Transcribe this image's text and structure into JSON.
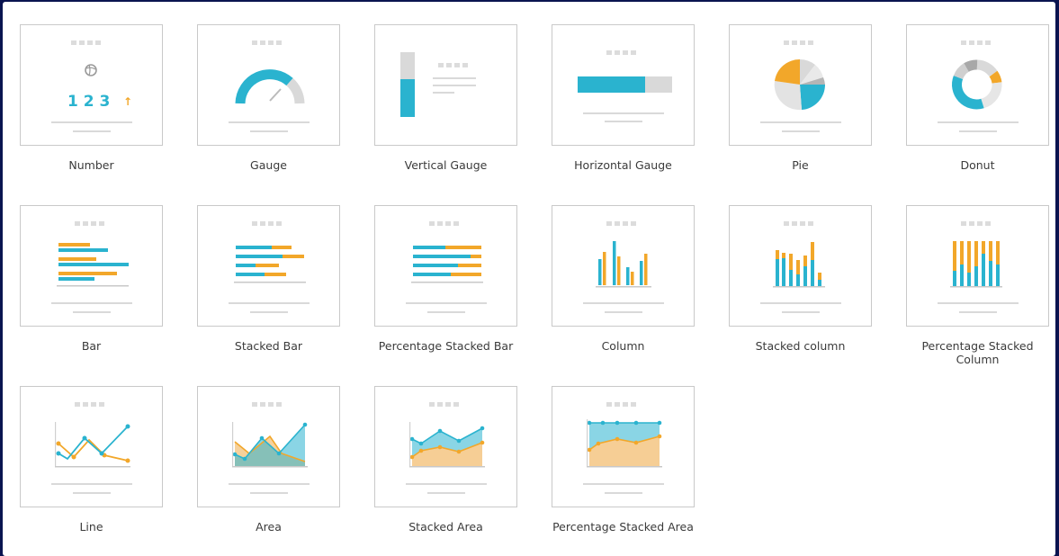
{
  "chart_types": [
    {
      "label": "Number",
      "icon": "number-icon"
    },
    {
      "label": "Gauge",
      "icon": "gauge-icon"
    },
    {
      "label": "Vertical Gauge",
      "icon": "vertical-gauge-icon"
    },
    {
      "label": "Horizontal Gauge",
      "icon": "horizontal-gauge-icon"
    },
    {
      "label": "Pie",
      "icon": "pie-chart-icon"
    },
    {
      "label": "Donut",
      "icon": "donut-chart-icon"
    },
    {
      "label": "Bar",
      "icon": "bar-chart-icon"
    },
    {
      "label": "Stacked Bar",
      "icon": "stacked-bar-chart-icon"
    },
    {
      "label": "Percentage Stacked Bar",
      "icon": "percentage-stacked-bar-chart-icon"
    },
    {
      "label": "Column",
      "icon": "column-chart-icon"
    },
    {
      "label": "Stacked column",
      "icon": "stacked-column-chart-icon"
    },
    {
      "label": "Percentage Stacked Column",
      "icon": "percentage-stacked-column-chart-icon"
    },
    {
      "label": "Line",
      "icon": "line-chart-icon"
    },
    {
      "label": "Area",
      "icon": "area-chart-icon"
    },
    {
      "label": "Stacked Area",
      "icon": "stacked-area-chart-icon"
    },
    {
      "label": "Percentage Stacked Area",
      "icon": "percentage-stacked-area-chart-icon"
    }
  ],
  "number_preview": {
    "value": "1 2 3",
    "trend": "↑"
  },
  "colors": {
    "frame": "#0a1450",
    "teal": "#2ab3cf",
    "orange": "#f2a72a",
    "light_gray": "#d9d9d9",
    "placeholder": "#dcdcdc",
    "border": "#c9c9c9",
    "text": "#3b3b3b"
  }
}
